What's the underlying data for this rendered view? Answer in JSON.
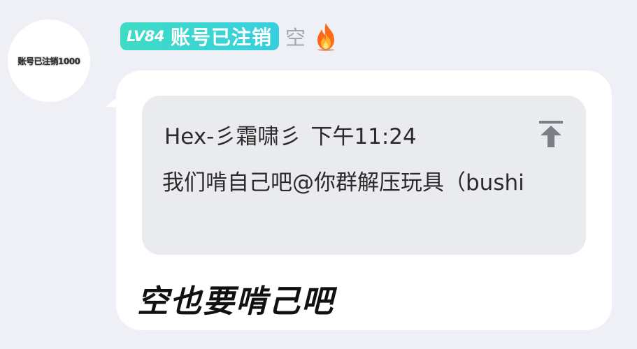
{
  "sender": {
    "avatar_text": "账号已注销1000",
    "level": "LV84",
    "name": "账号已注销",
    "title": "空",
    "badge_icon": "fire-icon"
  },
  "quote": {
    "author": "Hex-彡霜啸彡",
    "time": "下午11:24",
    "text": "我们啃自己吧@你群解压玩具（bushi",
    "jump_icon": "scroll-to-top-icon"
  },
  "message": {
    "text": "空也要啃己吧"
  },
  "colors": {
    "background": "#eff0f5",
    "bubble": "#ffffff",
    "quote_background": "#eaebee",
    "level_badge": "#3fdcc4",
    "title_gray": "#a3a6ae"
  }
}
